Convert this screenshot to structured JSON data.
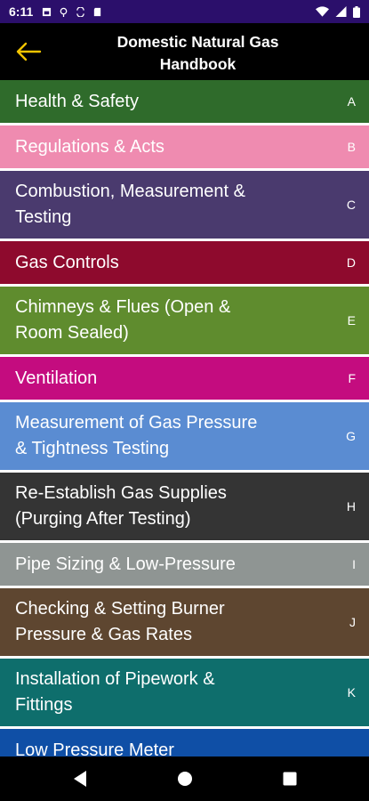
{
  "status_bar": {
    "time": "6:11",
    "icons_left": [
      "photo-icon",
      "location-icon",
      "sync-icon",
      "sd-card-icon"
    ],
    "icons_right": [
      "wifi-icon",
      "signal-icon",
      "battery-icon"
    ]
  },
  "app_bar": {
    "title": "Domestic Natural Gas\nHandbook",
    "back_icon": "arrow-left-icon",
    "back_color": "#f2c400"
  },
  "sections": [
    {
      "label": "Health & Safety",
      "letter": "A",
      "color": "#2f6b2b"
    },
    {
      "label": "Regulations & Acts",
      "letter": "B",
      "color": "#ef8bb0"
    },
    {
      "label": "Combustion, Measurement &\nTesting",
      "letter": "C",
      "color": "#4a3a6e"
    },
    {
      "label": "Gas Controls",
      "letter": "D",
      "color": "#8e0a2d"
    },
    {
      "label": "Chimneys & Flues (Open &\nRoom Sealed)",
      "letter": "E",
      "color": "#5f8c2e"
    },
    {
      "label": "Ventilation",
      "letter": "F",
      "color": "#c40c7f"
    },
    {
      "label": "Measurement of Gas Pressure\n& Tightness Testing",
      "letter": "G",
      "color": "#5a8cd2"
    },
    {
      "label": "Re-Establish Gas Supplies\n(Purging After Testing)",
      "letter": "H",
      "color": "#343434"
    },
    {
      "label": "Pipe Sizing & Low-Pressure",
      "letter": "I",
      "color": "#8f9593"
    },
    {
      "label": "Checking & Setting Burner\nPressure & Gas Rates",
      "letter": "J",
      "color": "#5e4630"
    },
    {
      "label": "Installation of Pipework &\nFittings",
      "letter": "K",
      "color": "#0e6e6c"
    },
    {
      "label": "Low Pressure Meter",
      "letter": "",
      "color": "#0f4fa6"
    }
  ],
  "nav": {
    "back": "back-icon",
    "home": "home-icon",
    "recents": "recents-icon"
  }
}
